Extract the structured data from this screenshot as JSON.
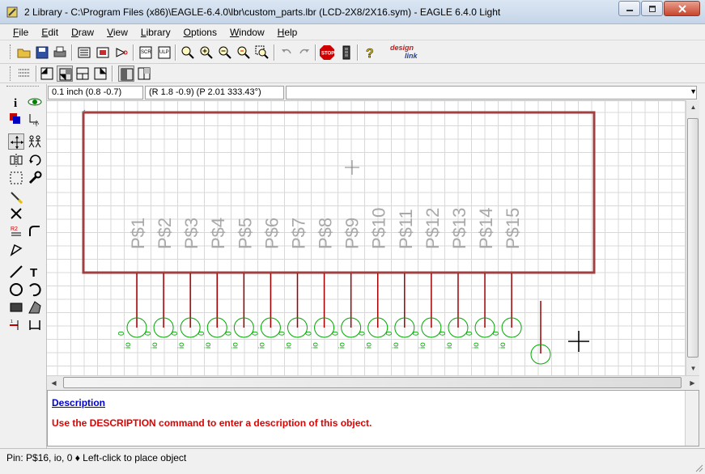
{
  "window": {
    "title": "2 Library - C:\\Program Files (x86)\\EAGLE-6.4.0\\lbr\\custom_parts.lbr (LCD-2X8/2X16.sym) - EAGLE 6.4.0 Light"
  },
  "menu": [
    "File",
    "Edit",
    "Draw",
    "View",
    "Library",
    "Options",
    "Window",
    "Help"
  ],
  "toolbar": {
    "icons": [
      "open-icon",
      "save-icon",
      "print-icon",
      "board-icon",
      "schematic-icon",
      "symbol-icon",
      "script-icon",
      "ulp-icon",
      "zoom-fit-icon",
      "zoom-in-icon",
      "zoom-out-icon",
      "zoom-redraw-icon",
      "zoom-select-icon",
      "undo-icon",
      "redo-icon",
      "stop-icon",
      "go-icon",
      "help-icon"
    ],
    "brand_line1": "design",
    "brand_line2": "link"
  },
  "coords": {
    "grid_and_position": "0.1 inch (0.8 -0.7)",
    "relative_polar": "(R 1.8 -0.9) (P 2.01 333.43°)"
  },
  "symbol": {
    "pins": [
      "P$1",
      "P$2",
      "P$3",
      "P$4",
      "P$5",
      "P$6",
      "P$7",
      "P$8",
      "P$9",
      "P$10",
      "P$11",
      "P$12",
      "P$13",
      "P$14",
      "P$15"
    ],
    "pin_io_label": "io",
    "pin_swap_label": "0"
  },
  "description": {
    "link": "Description",
    "message": "Use the DESCRIPTION command to enter a description of this object."
  },
  "status": {
    "text": "Pin: P$16, io, 0  ♦ Left-click to place object"
  },
  "colors": {
    "symbol_outline": "#a04040",
    "pin_line": "#a00000",
    "pin_name": "#a8a8a8",
    "pin_circle": "#00aa00",
    "grid": "#d8d8d8"
  }
}
